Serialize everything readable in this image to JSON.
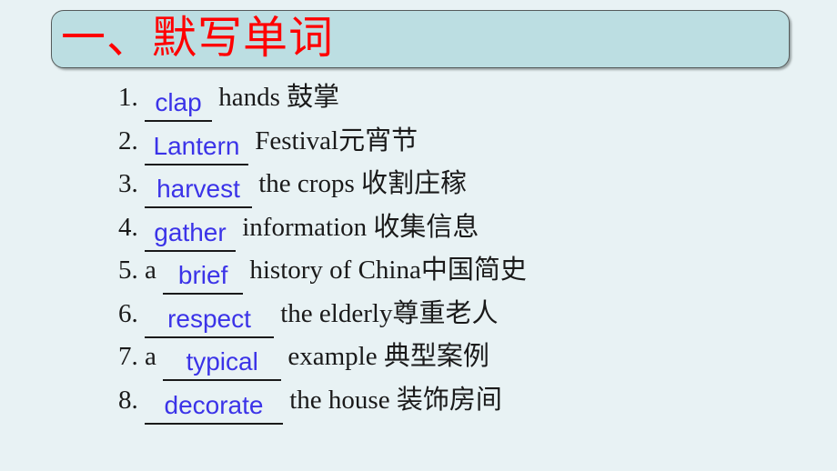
{
  "slide": {
    "background_color": "#e8f2f4"
  },
  "title": {
    "text": "一、默写单词",
    "color": "#ff0000",
    "banner_color": "#bcdee2",
    "banner_border_color": "#555b5b"
  },
  "list": {
    "blank_color": "#3b33e8",
    "items": [
      {
        "number": "1.",
        "pre": "",
        "blank": "clap",
        "blank_width": 74,
        "post": " hands ",
        "cn": "鼓掌"
      },
      {
        "number": "2.",
        "pre": "",
        "blank": "Lantern",
        "blank_width": 114,
        "post": " Festival",
        "cn": "元宵节"
      },
      {
        "number": "3.",
        "pre": "",
        "blank": "harvest",
        "blank_width": 118,
        "post": " the crops ",
        "cn": "收割庄稼"
      },
      {
        "number": "4.",
        "pre": "",
        "blank": "gather",
        "blank_width": 100,
        "post": " information ",
        "cn": "收集信息"
      },
      {
        "number": "5.",
        "pre": " a ",
        "blank": "brief",
        "blank_width": 88,
        "post": " history of China",
        "cn": "中国简史"
      },
      {
        "number": "6.",
        "pre": "",
        "blank": "respect",
        "blank_width": 142,
        "post": " the elderly",
        "cn": "尊重老人"
      },
      {
        "number": "7.",
        "pre": " a ",
        "blank": "typical",
        "blank_width": 130,
        "post": " example ",
        "cn": "典型案例"
      },
      {
        "number": "8.",
        "pre": "",
        "blank": "decorate",
        "blank_width": 152,
        "post": " the house ",
        "cn": "装饰房间"
      }
    ]
  }
}
